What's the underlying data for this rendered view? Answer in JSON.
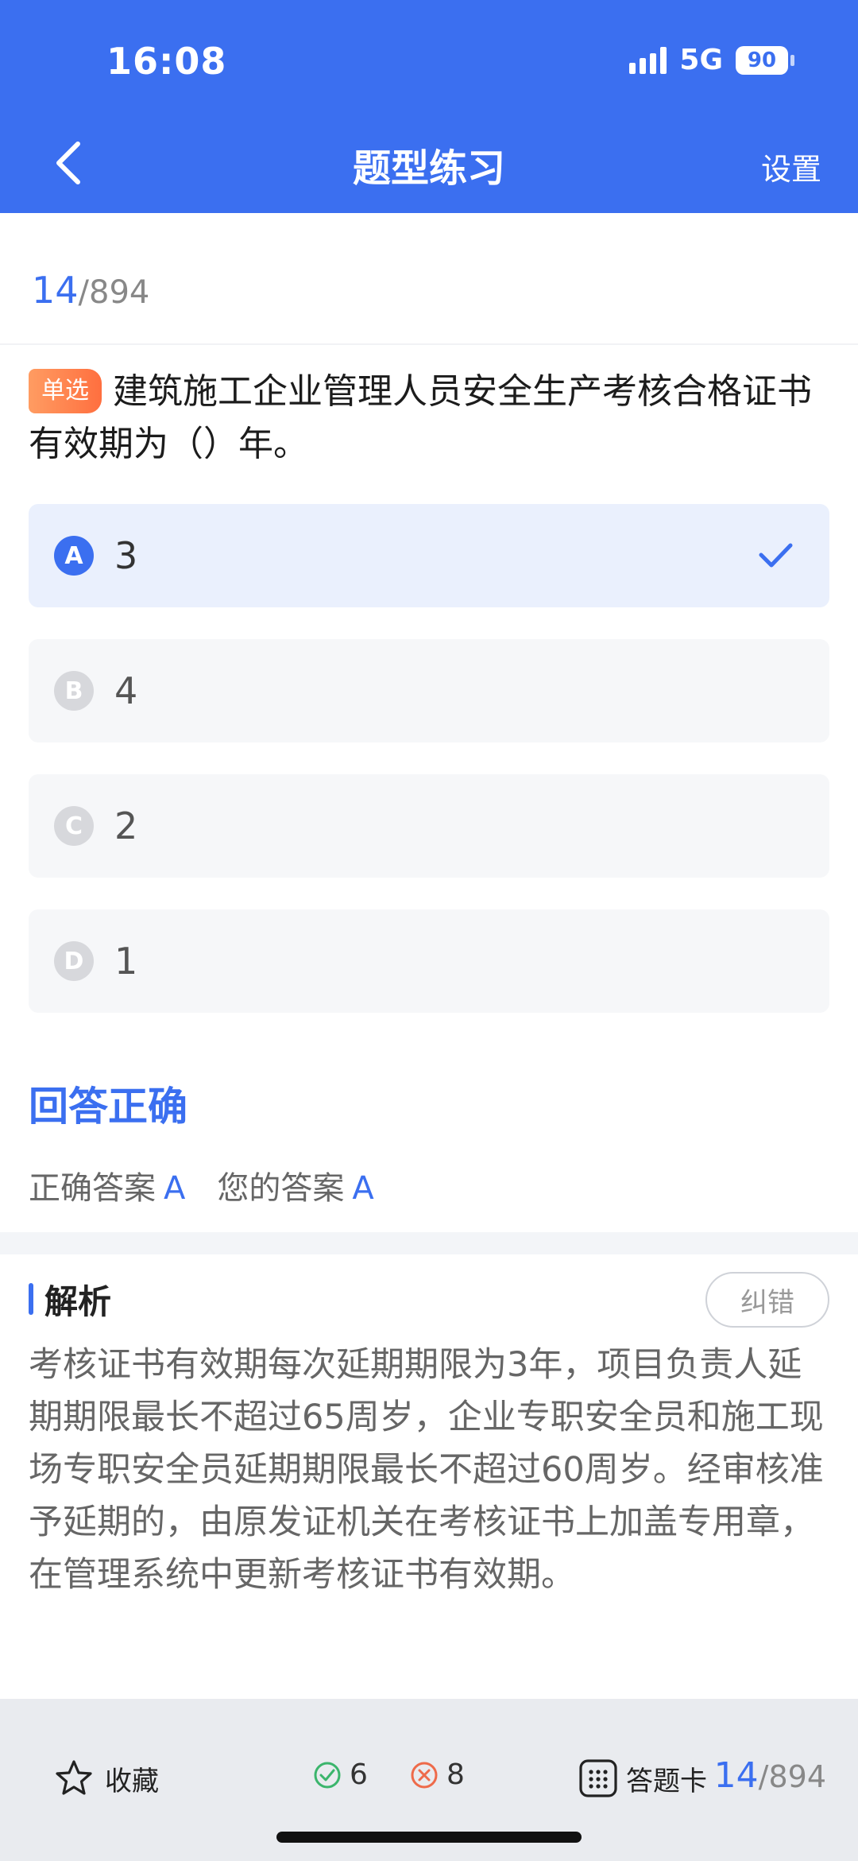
{
  "status": {
    "time": "16:08",
    "network": "5G",
    "battery": "90"
  },
  "nav": {
    "title": "题型练习",
    "settings": "设置"
  },
  "progress": {
    "current": "14",
    "total": "/894"
  },
  "question": {
    "type_tag": "单选",
    "text": "建筑施工企业管理人员安全生产考核合格证书有效期为（）年。"
  },
  "options": [
    {
      "letter": "A",
      "text": "3",
      "selected": true
    },
    {
      "letter": "B",
      "text": "4",
      "selected": false
    },
    {
      "letter": "C",
      "text": "2",
      "selected": false
    },
    {
      "letter": "D",
      "text": "1",
      "selected": false
    }
  ],
  "result": {
    "title": "回答正确",
    "correct_label": "正确答案",
    "correct_value": "A",
    "yours_label": "您的答案",
    "yours_value": "A"
  },
  "explanation": {
    "title": "解析",
    "report_label": "纠错",
    "body": "考核证书有效期每次延期期限为3年，项目负责人延期期限最长不超过65周岁，企业专职安全员和施工现场专职安全员延期期限最长不超过60周岁。经审核准予延期的，由原发证机关在考核证书上加盖专用章，在管理系统中更新考核证书有效期。"
  },
  "bottom": {
    "favorite_label": "收藏",
    "correct_count": "6",
    "wrong_count": "8",
    "card_label": "答题卡",
    "progress_current": "14",
    "progress_total": "/894"
  },
  "colors": {
    "accent": "#3b6ff0",
    "correct": "#3bb56c",
    "wrong": "#ee6a4a",
    "tag": "#ff7a45"
  },
  "icons": [
    "back-arrow-icon",
    "check-icon",
    "star-icon",
    "correct-circle-icon",
    "wrong-circle-icon",
    "grid-icon"
  ]
}
